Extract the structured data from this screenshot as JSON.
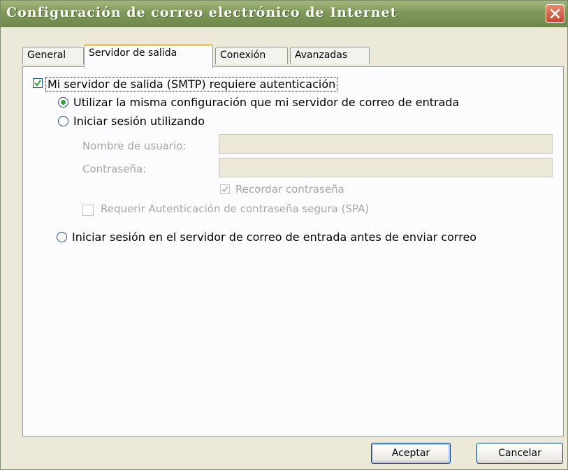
{
  "window": {
    "title": "Configuración de correo electrónico de Internet"
  },
  "tabs": [
    {
      "label": "General",
      "active": false
    },
    {
      "label": "Servidor de salida",
      "active": true
    },
    {
      "label": "Conexión",
      "active": false
    },
    {
      "label": "Avanzadas",
      "active": false
    }
  ],
  "smtp": {
    "requires_auth_label": "Mi servidor de salida (SMTP) requiere autenticación",
    "requires_auth_checked": true,
    "use_same_settings_label": "Utilizar la misma configuración que mi servidor de correo de entrada",
    "use_same_settings_selected": true,
    "log_on_using_label": "Iniciar sesión utilizando",
    "log_on_using_selected": false,
    "username_label": "Nombre de usuario:",
    "username_value": "",
    "password_label": "Contraseña:",
    "password_value": "",
    "remember_password_label": "Recordar contraseña",
    "remember_password_checked": true,
    "spa_label": "Requerir Autenticación de contraseña segura (SPA)",
    "spa_checked": false,
    "log_on_incoming_first_label": "Iniciar sesión en el servidor de correo de entrada antes de enviar correo",
    "log_on_incoming_first_selected": false
  },
  "buttons": {
    "ok_label": "Aceptar",
    "cancel_label": "Cancelar"
  },
  "colors": {
    "titlebar": "#7f9859",
    "dialog_bg": "#ece9d8",
    "active_tab_highlight": "#ffc83c",
    "check_green": "#2fa82f",
    "close_button": "#c8442a"
  }
}
